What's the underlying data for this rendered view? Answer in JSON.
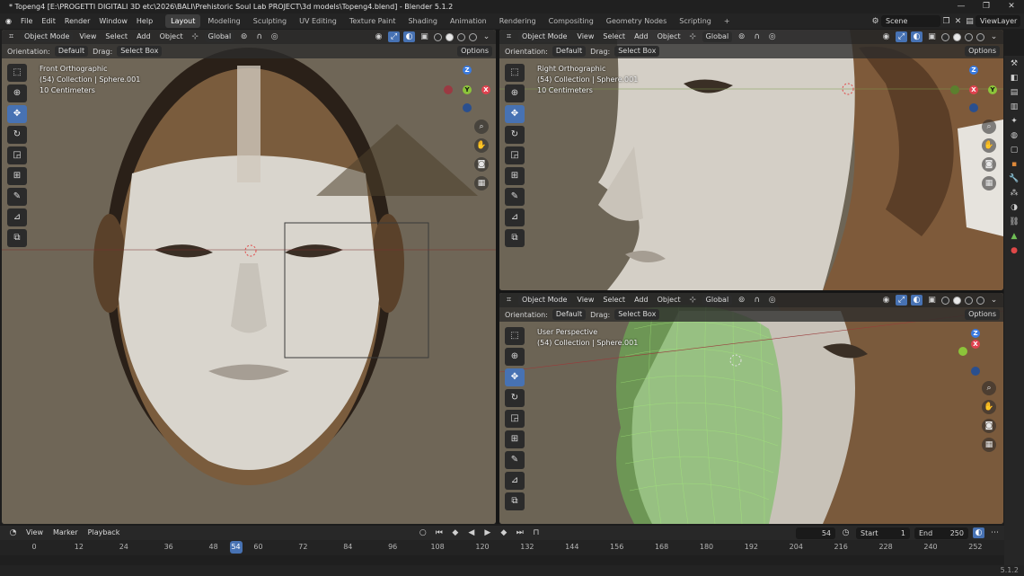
{
  "titlebar": {
    "title": "* Topeng4 [E:\\PROGETTI DIGITALI 3D etc\\2026\\BALI\\Prehistoric Soul Lab PROJECT\\3d models\\Topeng4.blend] - Blender 5.1.2",
    "minimize": "—",
    "maximize": "❐",
    "close": "✕"
  },
  "menubar": {
    "menus": [
      "File",
      "Edit",
      "Render",
      "Window",
      "Help"
    ],
    "workspaces": [
      "Layout",
      "Modeling",
      "Sculpting",
      "UV Editing",
      "Texture Paint",
      "Shading",
      "Animation",
      "Rendering",
      "Compositing",
      "Geometry Nodes",
      "Scripting"
    ],
    "add_workspace": "+",
    "scene": "Scene",
    "view_layer": "ViewLayer"
  },
  "viewport_header": {
    "mode": "Object Mode",
    "menus": [
      "View",
      "Select",
      "Add",
      "Object"
    ],
    "transform_orientation": "Global",
    "orientation_label": "Orientation:",
    "orientation_value": "Default",
    "drag_label": "Drag:",
    "drag_value": "Select Box",
    "options": "Options"
  },
  "viewports": {
    "front": {
      "view_name": "Front Orthographic",
      "collection": "(54) Collection | Sphere.001",
      "scale": "10 Centimeters"
    },
    "right": {
      "view_name": "Right Orthographic",
      "collection": "(54) Collection | Sphere.001",
      "scale": "10 Centimeters"
    },
    "persp": {
      "view_name": "User Perspective",
      "collection": "(54) Collection | Sphere.001"
    }
  },
  "gizmo_axes": {
    "x": "X",
    "y": "Y",
    "z": "Z"
  },
  "timeline": {
    "menus": [
      "View",
      "Marker",
      "Playback"
    ],
    "current_frame": "54",
    "start_label": "Start",
    "start": "1",
    "end_label": "End",
    "end": "250",
    "ticks": [
      "0",
      "12",
      "24",
      "36",
      "48",
      "60",
      "72",
      "84",
      "96",
      "108",
      "120",
      "132",
      "144",
      "156",
      "168",
      "180",
      "192",
      "204",
      "216",
      "228",
      "240",
      "252"
    ],
    "playhead": "54"
  },
  "status": {
    "version": "5.1.2"
  },
  "colors": {
    "accent": "#4772b3",
    "axis_x": "#e0424f",
    "axis_y": "#8cc43a",
    "axis_z": "#3a7be0",
    "viewport_bg": "#6e6556"
  }
}
